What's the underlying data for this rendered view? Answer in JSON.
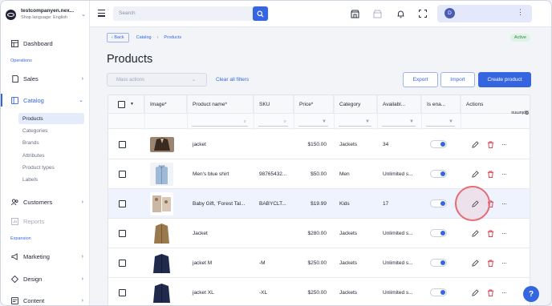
{
  "brand": {
    "name": "testcompanyen.nex...",
    "language": "Shop language: English"
  },
  "sidebar": {
    "dashboard": "Dashboard",
    "operations_label": "Operations",
    "sales": "Sales",
    "catalog": "Catalog",
    "catalog_items": [
      "Products",
      "Categories",
      "Brands",
      "Attributes",
      "Product types",
      "Labels"
    ],
    "customers": "Customers",
    "reports": "Reports",
    "expansion_label": "Expansion",
    "marketing": "Marketing",
    "design": "Design",
    "content": "Content"
  },
  "topbar": {
    "search_placeholder": "Search",
    "user_initial": "D"
  },
  "breadcrumb": {
    "back": "Back",
    "catalog": "Catalog",
    "products": "Products"
  },
  "status_badge": "Active",
  "page_title": "Products",
  "toolbar": {
    "mass_actions": "Mass actions",
    "clear_filters": "Clear all filters",
    "export": "Export",
    "import": "Import",
    "create": "Create product"
  },
  "table": {
    "headers": [
      "Image*",
      "Product name*",
      "SKU",
      "Price*",
      "Category",
      "Availabl...",
      "Is ena...",
      "Actions"
    ],
    "columns_tab": "Columns",
    "rows": [
      {
        "name": "jacket",
        "sku": "",
        "price": "$150.00",
        "category": "Jackets",
        "availability": "34"
      },
      {
        "name": "Men's blue shirt",
        "sku": "98765432...",
        "price": "$50.00",
        "category": "Men",
        "availability": "Unlimited s..."
      },
      {
        "name": "Baby Gift, 'Forest Tal...",
        "sku": "BABYCLT...",
        "price": "$19.99",
        "category": "Kids",
        "availability": "17"
      },
      {
        "name": "Jacket",
        "sku": "",
        "price": "$280.00",
        "category": "Jackets",
        "availability": "Unlimited s..."
      },
      {
        "name": "jacket M",
        "sku": "-M",
        "price": "$250.00",
        "category": "Jackets",
        "availability": "Unlimited s..."
      },
      {
        "name": "jacket XL",
        "sku": "-XL",
        "price": "$250.00",
        "category": "Jackets",
        "availability": "Unlimited s..."
      }
    ]
  },
  "colors": {
    "accent": "#3566e0",
    "delete": "#d93448",
    "highlight": "#e56a75"
  }
}
